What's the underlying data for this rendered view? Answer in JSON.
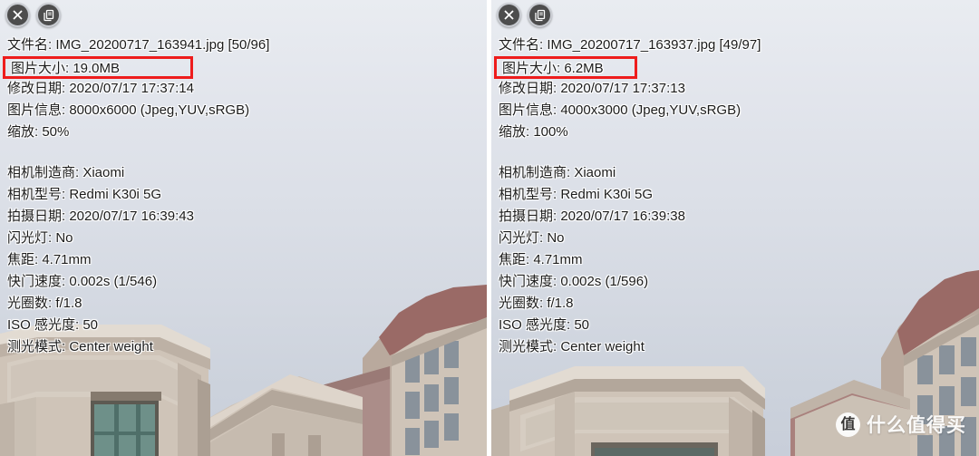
{
  "panels": [
    {
      "id": "left",
      "zoom_label": "50%",
      "toolbar": {
        "close_label": "✕",
        "close_icon": "close-icon",
        "copy_icon": "copy-documents-icon"
      },
      "file": {
        "filename_row": "文件名: IMG_20200717_163941.jpg [50/96]",
        "filesize_row": "图片大小: 19.0MB",
        "moddate_row": "修改日期: 2020/07/17 17:37:14",
        "imginfo_row": "图片信息: 8000x6000 (Jpeg,YUV,sRGB)",
        "zoom_row": "缩放: 50%"
      },
      "exif": [
        "相机制造商: Xiaomi",
        "相机型号: Redmi K30i 5G",
        "拍摄日期: 2020/07/17 16:39:43",
        "闪光灯: No",
        "焦距: 4.71mm",
        "快门速度: 0.002s (1/546)",
        "光圈数: f/1.8",
        "ISO 感光度: 50",
        "测光模式: Center weight"
      ],
      "highlight_color": "#ee1c1c"
    },
    {
      "id": "right",
      "zoom_label": "100%",
      "toolbar": {
        "close_label": "✕",
        "close_icon": "close-icon",
        "copy_icon": "copy-documents-icon"
      },
      "file": {
        "filename_row": "文件名: IMG_20200717_163937.jpg [49/97]",
        "filesize_row": "图片大小: 6.2MB",
        "moddate_row": "修改日期: 2020/07/17 17:37:13",
        "imginfo_row": "图片信息: 4000x3000 (Jpeg,YUV,sRGB)",
        "zoom_row": "缩放: 100%"
      },
      "exif": [
        "相机制造商: Xiaomi",
        "相机型号: Redmi K30i 5G",
        "拍摄日期: 2020/07/17 16:39:38",
        "闪光灯: No",
        "焦距: 4.71mm",
        "快门速度: 0.002s (1/596)",
        "光圈数: f/1.8",
        "ISO 感光度: 50",
        "测光模式: Center weight"
      ],
      "highlight_color": "#ee1c1c"
    }
  ],
  "watermark": {
    "logo_char": "值",
    "text": "什么值得买"
  },
  "colors": {
    "sky_top": "#e9ecf1",
    "sky_bottom": "#c8ced9",
    "stone": "#cfc4b8",
    "stone_shadow": "#b3a79b",
    "window_glass": "#6e9089",
    "roof_red": "#9a6a66",
    "button_fill": "#4d4d4d",
    "highlight": "#ee1c1c"
  }
}
